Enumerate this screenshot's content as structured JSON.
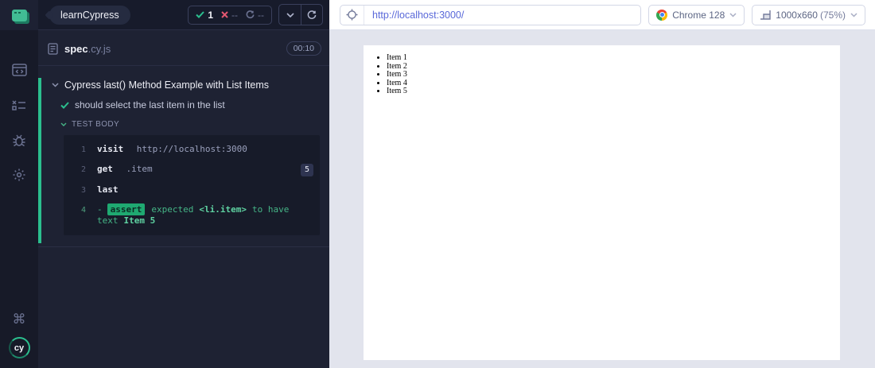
{
  "rail": {
    "logo": "cypress-app-logo",
    "items": [
      "specs",
      "runs",
      "debug",
      "settings"
    ],
    "keyboard_shortcuts": "command-key",
    "cy_logo_text": "cy"
  },
  "reporter": {
    "project": "learnCypress",
    "stats": {
      "passed": "1",
      "failed": "--",
      "pending": "--"
    },
    "spec": {
      "name": "spec",
      "ext": ".cy.js",
      "duration": "00:10"
    },
    "suite_title": "Cypress last() Method Example with List Items",
    "test_title": "should select the last item in the list",
    "section_label": "TEST BODY",
    "commands": [
      {
        "line": "1",
        "method": "visit",
        "message": "http://localhost:3000"
      },
      {
        "line": "2",
        "method": "get",
        "message": ".item",
        "count": "5"
      },
      {
        "line": "3",
        "method": "last",
        "message": ""
      },
      {
        "line": "4",
        "method": "assert",
        "prefix": "-",
        "parts": [
          {
            "text": "expected",
            "strong": false
          },
          {
            "text": "<li.item>",
            "strong": true
          },
          {
            "text": "to have text",
            "strong": false
          },
          {
            "text": "Item 5",
            "strong": true
          }
        ]
      }
    ]
  },
  "browser": {
    "url": "http://localhost:3000/",
    "browser_name": "Chrome 128",
    "viewport_size": "1000x660",
    "viewport_scale": "(75%)"
  },
  "page": {
    "items": [
      "Item 1",
      "Item 2",
      "Item 3",
      "Item 4",
      "Item 5"
    ]
  },
  "colors": {
    "accent_green": "#1fa971",
    "bright_green": "#2bbf8e",
    "fail_red": "#e45770",
    "url_text": "#5968d9",
    "panel_bg": "#1e2233",
    "rail_bg": "#171a28",
    "stage_bg": "#e2e4ed"
  }
}
